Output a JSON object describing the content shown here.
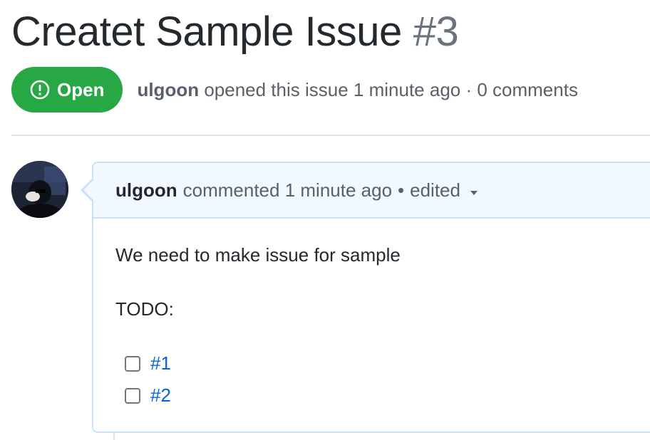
{
  "issue": {
    "title": "Createt Sample Issue",
    "number": "#3",
    "state_label": "Open",
    "author": "ulgoon",
    "meta_text": "opened this issue 1 minute ago · 0 comments"
  },
  "comment": {
    "author": "ulgoon",
    "action_text": "commented 1 minute ago",
    "separator": "•",
    "edited_label": "edited",
    "body_line1": "We need to make issue for sample",
    "body_line2": "TODO:",
    "tasks": [
      {
        "label": "#1",
        "checked": false
      },
      {
        "label": "#2",
        "checked": false
      }
    ]
  },
  "colors": {
    "open_green": "#28a745",
    "link_blue": "#0366d6",
    "header_bg": "#f1f8ff",
    "border_blue": "#c8e1ff"
  },
  "icons": {
    "state_icon": "issue-opened-icon",
    "edited_dropdown": "triangle-down-icon"
  }
}
